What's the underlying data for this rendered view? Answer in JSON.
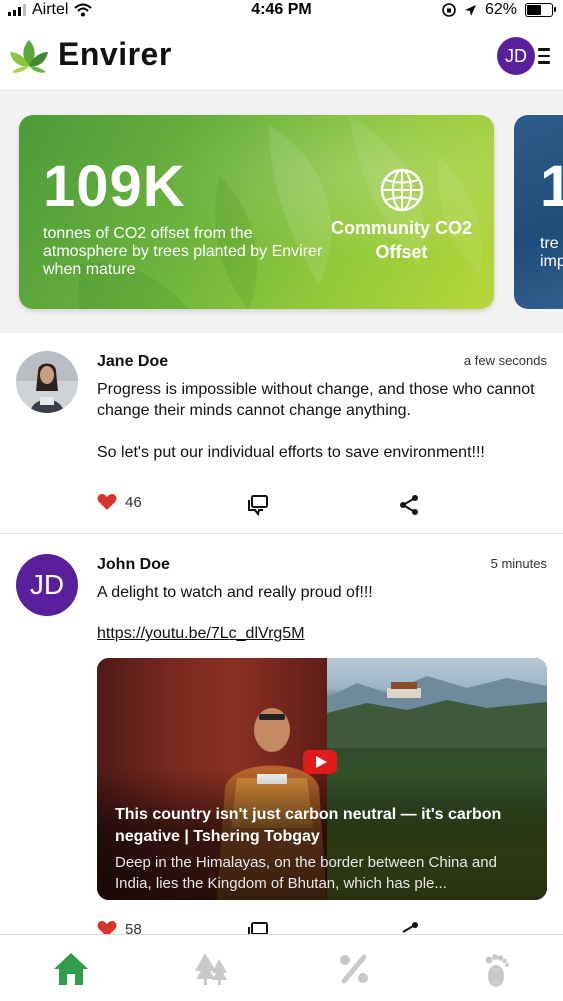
{
  "status_bar": {
    "carrier": "Airtel",
    "time": "4:46 PM",
    "battery_percent": "62%",
    "battery_level": 0.62
  },
  "header": {
    "app_title": "Envirer",
    "user_initials": "JD"
  },
  "stats": [
    {
      "value": "109K",
      "description": "tonnes of CO2 offset from the atmosphere by trees planted by Envirer when mature",
      "label": "Community CO2 Offset",
      "icon": "globe-icon"
    },
    {
      "value": "1",
      "description": "tre",
      "description_line2": "imp"
    }
  ],
  "posts": [
    {
      "author": "Jane Doe",
      "time": "a few seconds",
      "text_para1": "Progress is impossible without change, and those who cannot change their minds cannot change anything.",
      "text_para2": "So let's put our individual efforts to save environment!!!",
      "likes": "46"
    },
    {
      "author": "John Doe",
      "initials": "JD",
      "time": "5 minutes",
      "text": "A delight to watch and really proud of!!!",
      "link": "https://youtu.be/7Lc_dlVrg5M",
      "video": {
        "title": "This country isn't just carbon neutral — it's carbon negative | Tshering Tobgay",
        "description": "Deep in the Himalayas, on the border between China and India, lies the Kingdom of Bhutan, which has ple..."
      },
      "likes": "58"
    }
  ],
  "bottom_nav": [
    "home-icon",
    "trees-icon",
    "percent-icon",
    "footprint-icon"
  ],
  "colors": {
    "brand_purple": "#5a1f9a",
    "nav_active": "#2e9e4a",
    "nav_inactive": "#c8c8c8",
    "like_red": "#d9342b"
  }
}
